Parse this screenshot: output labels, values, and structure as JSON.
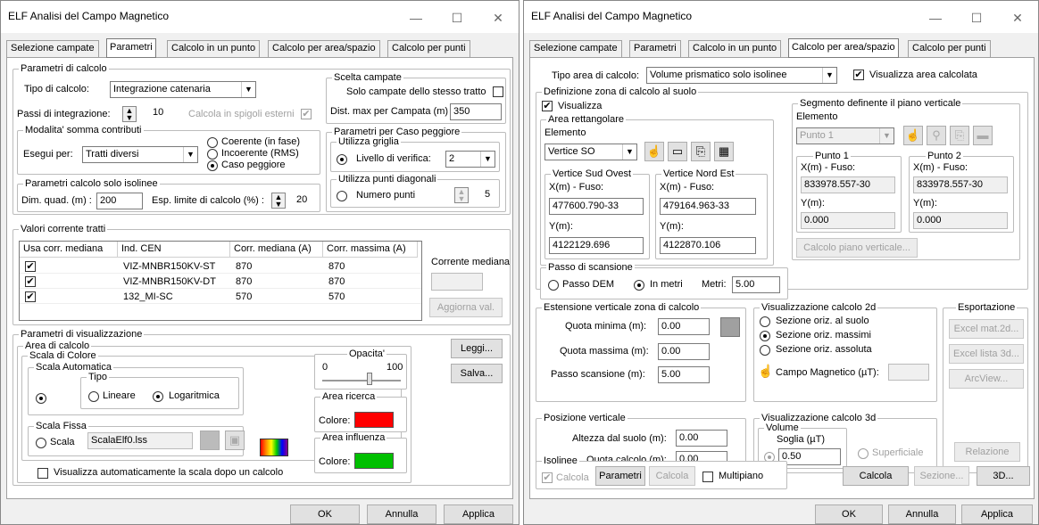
{
  "left": {
    "title": "ELF Analisi del Campo Magnetico",
    "tabs": [
      "Selezione campate",
      "Parametri",
      "Calcolo in un punto",
      "Calcolo per area/spazio",
      "Calcolo per punti"
    ],
    "calc_params": {
      "legend": "Parametri di calcolo",
      "tipo_label": "Tipo di calcolo:",
      "tipo_value": "Integrazione catenaria",
      "passi_label": "Passi di integrazione:",
      "passi_value": "10",
      "spigoli_label": "Calcola in spigoli esterni",
      "modalita_legend": "Modalita' somma contributi",
      "esegui_label": "Esegui per:",
      "esegui_value": "Tratti diversi",
      "coerente": "Coerente (in fase)",
      "incoerente": "Incoerente (RMS)",
      "peggiore": "Caso peggiore",
      "isolinee_legend": "Parametri calcolo solo isolinee",
      "dim_label": "Dim. quad. (m) :",
      "dim_value": "200",
      "esp_label": "Esp. limite di calcolo (%) :",
      "esp_value": "20"
    },
    "scelta": {
      "legend": "Scelta campate",
      "solo_label": "Solo campate dello stesso tratto",
      "dist_label": "Dist. max per Campata (m) :",
      "dist_value": "350"
    },
    "peggiore": {
      "legend": "Parametri per Caso peggiore",
      "griglia_legend": "Utilizza griglia",
      "livello_label": "Livello di verifica:",
      "livello_value": "2",
      "diag_legend": "Utilizza punti diagonali",
      "numero_label": "Numero punti",
      "numero_value": "5"
    },
    "valori": {
      "legend": "Valori corrente tratti",
      "columns": [
        "Usa corr. mediana",
        "Ind. CEN",
        "Corr. mediana (A)",
        "Corr. massima (A)"
      ],
      "rows": [
        [
          "✔",
          "VIZ-MNBR150KV-ST",
          "870",
          "870"
        ],
        [
          "✔",
          "VIZ-MNBR150KV-DT",
          "870",
          "870"
        ],
        [
          "✔",
          "132_MI-SC",
          "570",
          "570"
        ]
      ],
      "corrente_label": "Corrente mediana",
      "aggiorna": "Aggiorna val."
    },
    "vis": {
      "legend": "Parametri di visualizzazione",
      "area_legend": "Area di calcolo",
      "scala_colore": "Scala di Colore",
      "scala_auto": "Scala Automatica",
      "tipo": "Tipo",
      "lineare": "Lineare",
      "logaritmica": "Logaritmica",
      "scala_fissa": "Scala Fissa",
      "scala": "Scala",
      "scala_file": "ScalaElf0.lss",
      "opacita": "Opacita'",
      "op_min": "0",
      "op_max": "100",
      "area_ricerca": "Area ricerca",
      "colore": "Colore:",
      "area_influenza": "Area influenza",
      "auto_scala": "Visualizza automaticamente la scala dopo un calcolo",
      "leggi": "Leggi...",
      "salva": "Salva...",
      "ricerca_color": "#ff0000",
      "influenza_color": "#00c000"
    },
    "ok": "OK",
    "annulla": "Annulla",
    "applica": "Applica"
  },
  "right": {
    "title": "ELF Analisi del Campo Magnetico",
    "tabs": [
      "Selezione campate",
      "Parametri",
      "Calcolo in un punto",
      "Calcolo per area/spazio",
      "Calcolo per punti"
    ],
    "tipo_area_label": "Tipo area di calcolo:",
    "tipo_area_value": "Volume prismatico solo isolinee",
    "vis_area": "Visualizza area calcolata",
    "def": {
      "legend": "Definizione zona di calcolo al suolo",
      "visualizza": "Visualizza",
      "rett_legend": "Area rettangolare",
      "elemento": "Elemento",
      "vertice": "Vertice SO",
      "so_legend": "Vertice Sud Ovest",
      "ne_legend": "Vertice Nord Est",
      "x_label": "X(m) - Fuso:",
      "y_label": "Y(m):",
      "so_x": "477600.790-33",
      "so_y": "4122129.696",
      "ne_x": "479164.963-33",
      "ne_y": "4122870.106"
    },
    "seg": {
      "legend": "Segmento definente il piano verticale",
      "elemento": "Elemento",
      "punto": "Punto 1",
      "p1": "Punto 1",
      "p2": "Punto 2",
      "x_label": "X(m) - Fuso:",
      "y_label": "Y(m):",
      "p1_x": "833978.557-30",
      "p1_y": "0.000",
      "p2_x": "833978.557-30",
      "p2_y": "0.000",
      "calc_piano": "Calcolo piano verticale..."
    },
    "passo": {
      "legend": "Passo di scansione",
      "dem": "Passo DEM",
      "metri_radio": "In metri",
      "metri_label": "Metri:",
      "metri_value": "5.00"
    },
    "est": {
      "legend": "Estensione verticale zona di calcolo",
      "qmin_label": "Quota minima (m):",
      "qmin": "0.00",
      "qmax_label": "Quota massima (m):",
      "qmax": "0.00",
      "passo_label": "Passo scansione (m):",
      "passo": "5.00"
    },
    "v2d": {
      "legend": "Visualizzazione calcolo 2d",
      "suolo": "Sezione oriz. al suolo",
      "massimi": "Sezione oriz. massimi",
      "assoluta": "Sezione oriz. assoluta",
      "campo": "Campo Magnetico (µT):"
    },
    "exp": {
      "legend": "Esportazione",
      "excel2d": "Excel mat.2d...",
      "excel3d": "Excel lista 3d...",
      "arcview": "ArcView...",
      "relazione": "Relazione"
    },
    "pos": {
      "legend": "Posizione verticale",
      "alt_label": "Altezza dal suolo (m):",
      "alt": "0.00",
      "quota_label": "Quota calcolo (m):",
      "quota": "0.00"
    },
    "v3d": {
      "legend": "Visualizzazione calcolo 3d",
      "volume": "Volume",
      "soglia": "Soglia (µT)",
      "soglia_value": "0.50",
      "superficiale": "Superficiale"
    },
    "iso": {
      "legend": "Isolinee",
      "calcola_chk": "Calcola",
      "parametri": "Parametri",
      "calcola_btn": "Calcola",
      "multipiano": "Multipiano"
    },
    "calcola": "Calcola",
    "sezione": "Sezione...",
    "b3d": "3D...",
    "ok": "OK",
    "annulla": "Annulla",
    "applica": "Applica"
  }
}
